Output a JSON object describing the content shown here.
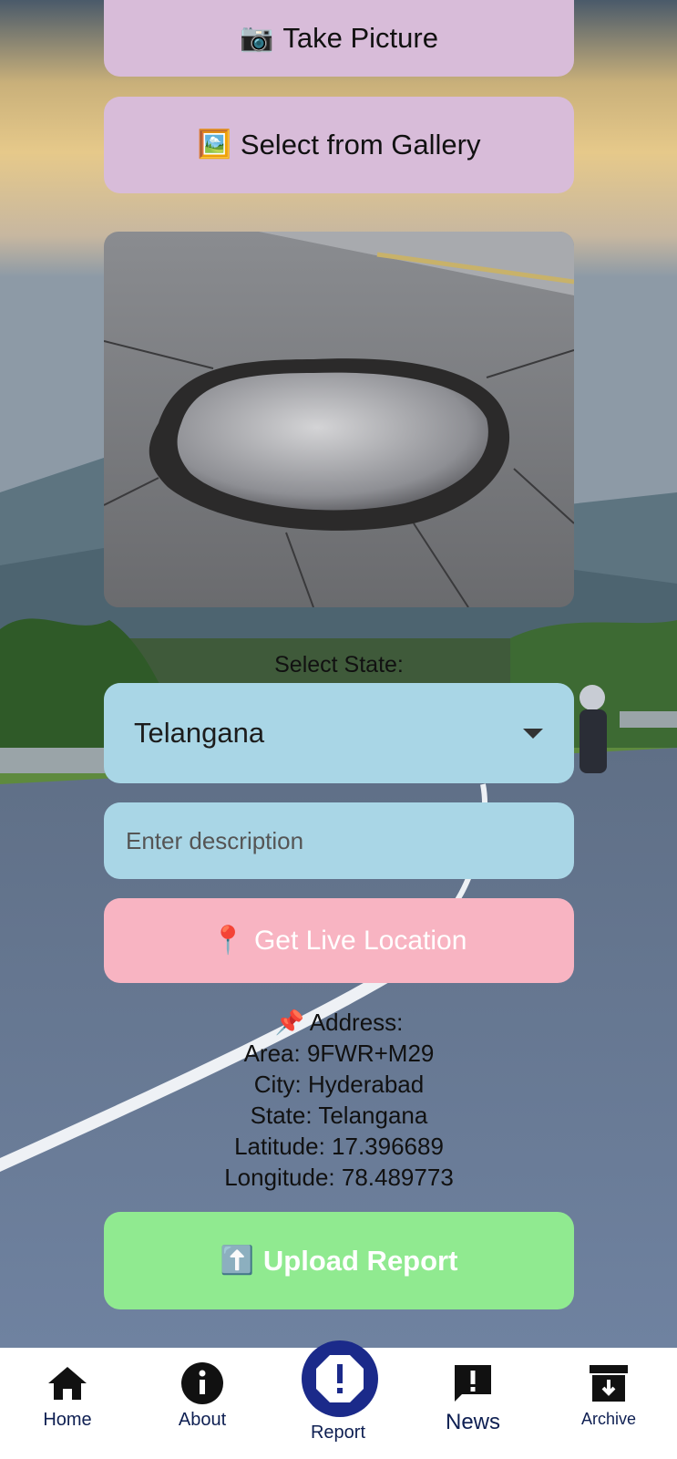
{
  "buttons": {
    "take_picture": {
      "icon": "camera-icon",
      "glyph": "📷",
      "label": "Take Picture"
    },
    "select_gallery": {
      "icon": "framed-picture-icon",
      "glyph": "🖼️",
      "label": "Select from Gallery"
    },
    "live_location": {
      "icon": "round-pushpin-icon",
      "glyph": "📍",
      "label": "Get Live Location"
    },
    "upload_report": {
      "icon": "up-arrow-icon",
      "glyph": "⬆️",
      "label": "Upload Report"
    }
  },
  "state_select": {
    "label": "Select State:",
    "selected": "Telangana"
  },
  "description": {
    "value": "",
    "placeholder": "Enter description"
  },
  "address": {
    "icon": "pushpin-icon",
    "heading": "📌 Address:",
    "area": "Area: 9FWR+M29",
    "city": "City: Hyderabad",
    "state": "State: Telangana",
    "latitude": "Latitude: 17.396689",
    "longitude": "Longitude: 78.489773"
  },
  "nav": {
    "items": [
      {
        "label": "Home",
        "icon": "home-icon"
      },
      {
        "label": "About",
        "icon": "info-icon"
      },
      {
        "label": "Report",
        "icon": "report-alert-icon",
        "active": true
      },
      {
        "label": "News",
        "icon": "news-alert-icon"
      },
      {
        "label": "Archive",
        "icon": "archive-icon"
      }
    ]
  },
  "colors": {
    "purple_button": "#d8bcd9",
    "blue_field": "#a9d6e6",
    "pink_button": "#f8b4c2",
    "green_button": "#90ea90",
    "nav_accent": "#1b2a8a",
    "nav_text": "#0e1f52"
  }
}
